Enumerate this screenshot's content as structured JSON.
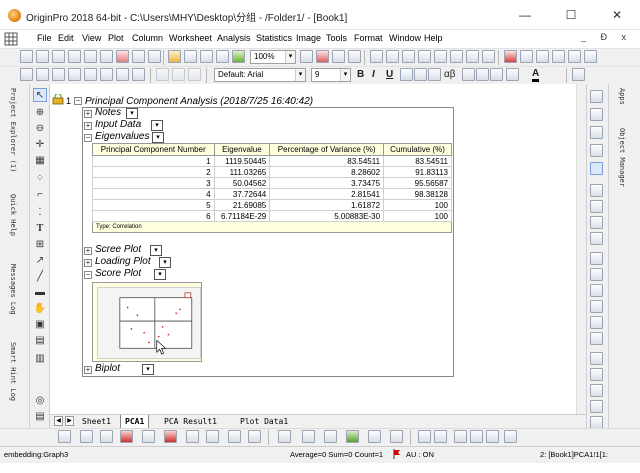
{
  "window": {
    "title": "OriginPro 2018 64-bit - C:\\Users\\MHY\\Desktop\\分组 - /Folder1/ - [Book1]",
    "minimize": "—",
    "maximize": "☐",
    "close": "✕"
  },
  "menu": {
    "items": [
      "File",
      "Edit",
      "View",
      "Plot",
      "Column",
      "Worksheet",
      "Analysis",
      "Statistics",
      "Image",
      "Tools",
      "Format",
      "Window",
      "Help"
    ],
    "mdi_controls": "_ Ɖ x"
  },
  "toolbar": {
    "zoom": "100%",
    "font_name": "Default: Arial",
    "font_size": "9",
    "bold": "B",
    "italic": "I",
    "underline": "U",
    "greek": "αβ",
    "text_a": "A"
  },
  "side_tabs": {
    "left": [
      "Project Explorer (1)",
      "Quick Help",
      "Messages Log",
      "Smart Hint Log"
    ],
    "right": [
      "Apps",
      "Object Manager"
    ]
  },
  "report": {
    "row_number": "1",
    "title": "Principal Component Analysis (2018/7/25 16:40:42)",
    "nodes": {
      "notes": "Notes",
      "input_data": "Input Data",
      "eigenvalues": "Eigenvalues",
      "scree_plot": "Scree Plot",
      "loading_plot": "Loading Plot",
      "score_plot": "Score Plot",
      "biplot": "Biplot"
    },
    "table": {
      "headers": [
        "Principal Component Number",
        "Eigenvalue",
        "Percentage of Variance (%)",
        "Cumulative (%)"
      ],
      "rows": [
        [
          "1",
          "1119.50445",
          "83.54511",
          "83.54511"
        ],
        [
          "2",
          "111.03265",
          "8.28602",
          "91.83113"
        ],
        [
          "3",
          "50.04562",
          "3.73475",
          "95.56587"
        ],
        [
          "4",
          "37.72644",
          "2.81541",
          "98.38128"
        ],
        [
          "5",
          "21.69085",
          "1.61872",
          "100"
        ],
        [
          "6",
          "6.71184E-29",
          "5.00883E-30",
          "100"
        ]
      ],
      "note": "Type: Correlation"
    }
  },
  "sheet_tabs": [
    "Sheet1",
    "PCA1",
    "PCA Result1",
    "Plot Data1"
  ],
  "status": {
    "left": "embedding:Graph3",
    "stats": "Average=0 Sum=0 Count=1",
    "au": "AU : ON",
    "ref": "2: [Book1]PCA1!1[1:"
  },
  "colors": {
    "accent": "#0078d7",
    "table_fill": "#ffffe0",
    "flag": "#cc0000"
  }
}
